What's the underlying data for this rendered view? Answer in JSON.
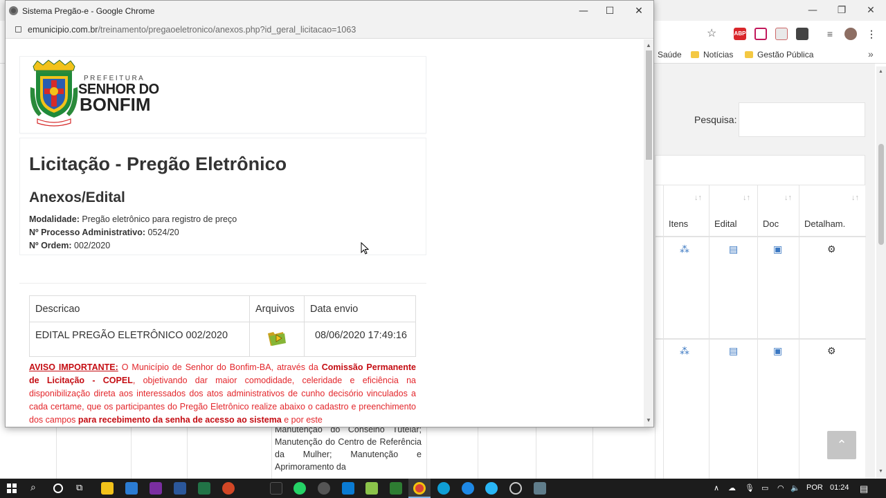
{
  "background_window": {
    "bookmarks": [
      "Saúde",
      "Notícias",
      "Gestão Pública"
    ],
    "search_label": "Pesquisa:",
    "table_headers": [
      "Itens",
      "Edital",
      "Doc",
      "Detalham."
    ],
    "partial_text": "Manutenção do Conselho Tutelar; Manutenção do Centro de Referência da Mulher; Manutenção e Aprimoramento da"
  },
  "popup": {
    "window_title": "Sistema Pregão-e - Google Chrome",
    "url_host": "emunicipio.com.br",
    "url_path": "/treinamento/pregaoeletronico/anexos.php?id_geral_licitacao=1063",
    "logo": {
      "prefeitura": "PREFEITURA",
      "city_line1": "SENHOR DO",
      "city_line2": "BONFIM"
    },
    "heading": "Licitação - Pregão Eletrônico",
    "subheading": "Anexos/Edital",
    "meta": {
      "modalidade_label": "Modalidade:",
      "modalidade_value": "Pregão eletrônico para registro de preço",
      "processo_label": "Nº Processo Administrativo:",
      "processo_value": "0524/20",
      "ordem_label": "Nº Ordem:",
      "ordem_value": "002/2020"
    },
    "files_table": {
      "headers": [
        "Descricao",
        "Arquivos",
        "Data envio"
      ],
      "rows": [
        {
          "descricao": "EDITAL PREGÃO ELETRÔNICO 002/2020",
          "data_envio": "08/06/2020 17:49:16"
        }
      ]
    },
    "notice": {
      "label": "AVISO IMPORTANTE:",
      "part1": " O Município de Senhor do Bonfim-BA, através da ",
      "bold1": "Comissão Permanente de Licitação - COPEL",
      "part2": ", objetivando dar maior comodidade, celeridade e eficiência na disponibilização direta aos interessados dos atos administrativos de cunho decisório vinculados a cada certame, que os participantes do Pregão Eletrônico realize abaixo o cadastro e preenchimento dos campos ",
      "bold2": "para recebimento da senha de acesso ao sistema",
      "part3": " e por este"
    }
  },
  "taskbar": {
    "language": "POR",
    "time": "01:24"
  }
}
